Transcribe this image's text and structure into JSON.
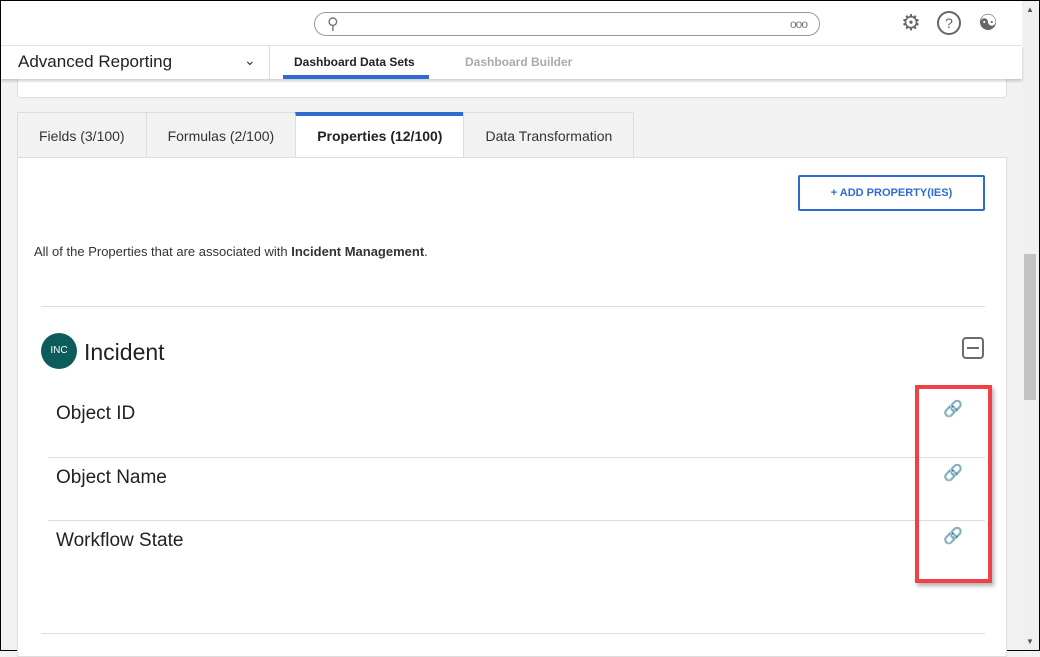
{
  "header": {
    "search_placeholder": "",
    "more_icon": "ooo"
  },
  "nav": {
    "app_title": "Advanced Reporting",
    "tabs": [
      {
        "label": "Dashboard Data Sets"
      },
      {
        "label": "Dashboard Builder"
      }
    ]
  },
  "tabs": [
    {
      "label": "Fields (3/100)"
    },
    {
      "label": "Formulas (2/100)"
    },
    {
      "label": "Properties (12/100)"
    },
    {
      "label": "Data Transformation"
    }
  ],
  "panel": {
    "add_button": "ADD PROPERTY(IES)",
    "desc_prefix": "All of the Properties that are associated with ",
    "desc_bold": "Incident Management",
    "desc_suffix": ".",
    "object": {
      "badge": "INC",
      "title": "Incident",
      "properties": [
        {
          "label": "Object ID"
        },
        {
          "label": "Object Name"
        },
        {
          "label": "Workflow State"
        }
      ]
    }
  },
  "colors": {
    "accent": "#2e6bd0",
    "badge": "#0e5b5b",
    "highlight": "#f04048"
  }
}
